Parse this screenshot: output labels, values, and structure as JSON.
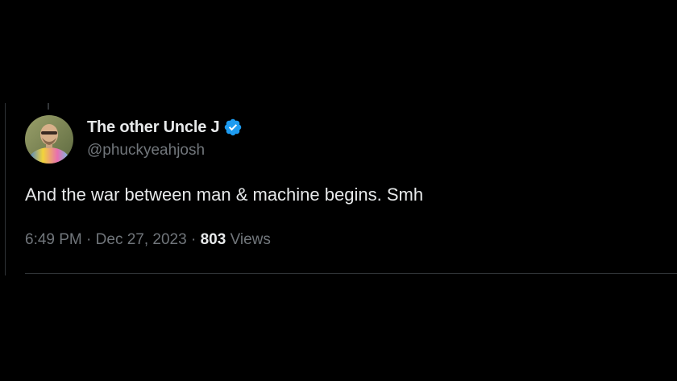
{
  "tweet": {
    "author": {
      "display_name": "The other Uncle J",
      "handle": "@phuckyeahjosh",
      "verified": true,
      "verified_icon": "verified-badge-icon",
      "verified_color": "#1d9bf0"
    },
    "text": "And the war between man & machine begins. Smh",
    "time": "6:49 PM",
    "separator": "·",
    "date": "Dec 27, 2023",
    "views_count": "803",
    "views_label": "Views"
  },
  "colors": {
    "background": "#000000",
    "primary_text": "#e7e9ea",
    "secondary_text": "#71767b",
    "border": "#2f3336"
  }
}
